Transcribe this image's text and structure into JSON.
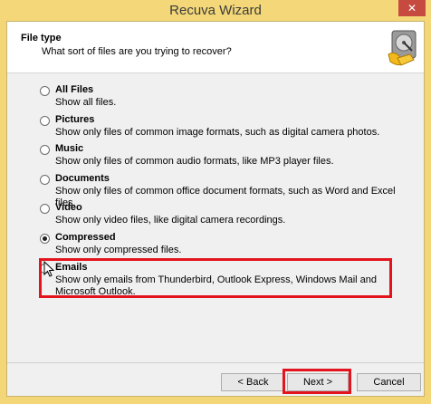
{
  "window": {
    "title": "Recuva Wizard",
    "close_symbol": "✕"
  },
  "header": {
    "title": "File type",
    "subtitle": "What sort of files are you trying to recover?",
    "icon": "hard-drive-icon"
  },
  "options": [
    {
      "label": "All Files",
      "description": "Show all files.",
      "checked": false
    },
    {
      "label": "Pictures",
      "description": "Show only files of common image formats, such as digital camera photos.",
      "checked": false
    },
    {
      "label": "Music",
      "description": "Show only files of common audio formats, like MP3 player files.",
      "checked": false
    },
    {
      "label": "Documents",
      "description": "Show only files of common office document formats, such as Word and Excel files.",
      "checked": false
    },
    {
      "label": "Video",
      "description": "Show only video files, like digital camera recordings.",
      "checked": false
    },
    {
      "label": "Compressed",
      "description": "Show only compressed files.",
      "checked": true
    },
    {
      "label": "Emails",
      "description": "Show only emails from Thunderbird, Outlook Express, Windows Mail and Microsoft Outlook.",
      "checked": false
    }
  ],
  "buttons": {
    "back": "< Back",
    "next": "Next >",
    "cancel": "Cancel"
  },
  "colors": {
    "titlebar": "#f3d778",
    "close_button": "#c74a41",
    "highlight": "#e3141e"
  }
}
